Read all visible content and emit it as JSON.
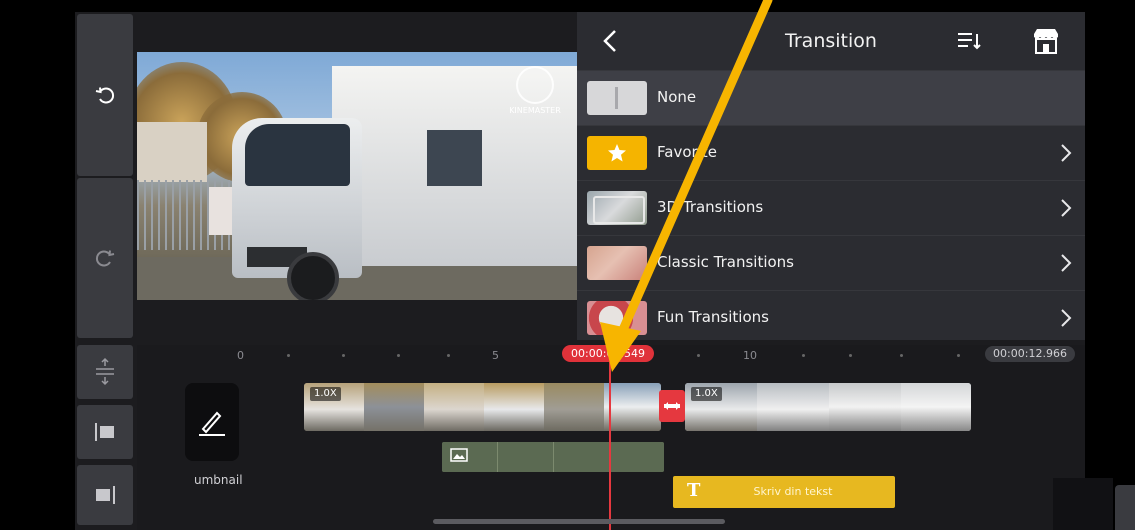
{
  "panel": {
    "title": "Transition",
    "items": [
      {
        "label": "None",
        "selected": true,
        "has_arrow": false
      },
      {
        "label": "Favorite",
        "selected": false,
        "has_arrow": true
      },
      {
        "label": "3D Transitions",
        "selected": false,
        "has_arrow": true
      },
      {
        "label": "Classic Transitions",
        "selected": false,
        "has_arrow": true
      },
      {
        "label": "Fun Transitions",
        "selected": false,
        "has_arrow": true
      }
    ]
  },
  "preview": {
    "logo_text": "KINEMASTER"
  },
  "timeline": {
    "ruler_numbers": [
      "0",
      "5",
      "10"
    ],
    "current_time": "00:00:06.549",
    "total_time": "00:00:12.966",
    "clip1_speed": "1.0X",
    "clip2_speed": "1.0X",
    "text_layer_label": "Skriv din tekst",
    "text_layer_icon": "T",
    "thumbnail_label": "umbnail"
  },
  "colors": {
    "accent_red": "#e5383f",
    "text_layer_yellow": "#e7b820",
    "favorite_yellow": "#f5b400",
    "arrow_orange": "#f7b500"
  },
  "icons": {
    "undo": "undo-icon",
    "redo": "redo-icon",
    "back": "chevron-left-icon",
    "sort": "sort-icon",
    "store": "store-icon",
    "pen": "pen-icon"
  }
}
